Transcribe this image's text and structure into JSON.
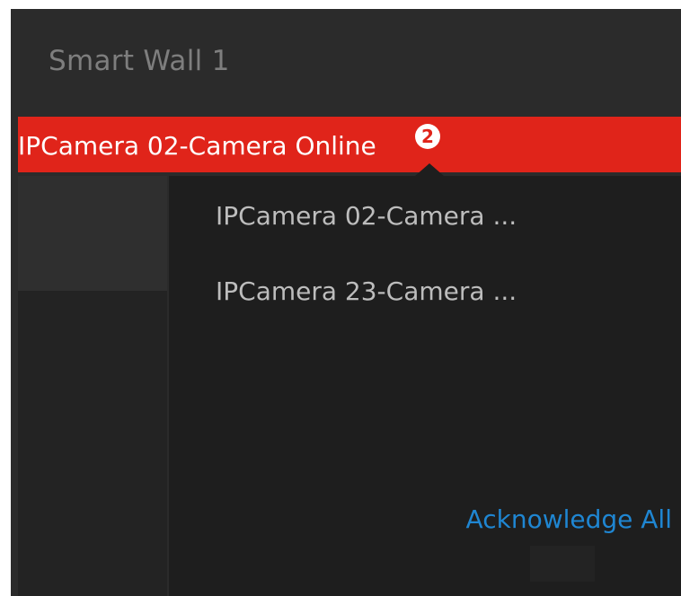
{
  "window": {
    "title": "Smart Wall 1"
  },
  "alarm": {
    "message": "IPCamera 02-Camera Online",
    "count": "2",
    "color": "#e0241a"
  },
  "popup": {
    "items": [
      {
        "label": "IPCamera 02-Camera ..."
      },
      {
        "label": "IPCamera 23-Camera ..."
      }
    ],
    "acknowledge_all": "Acknowledge All",
    "link_color": "#1f86d2"
  }
}
